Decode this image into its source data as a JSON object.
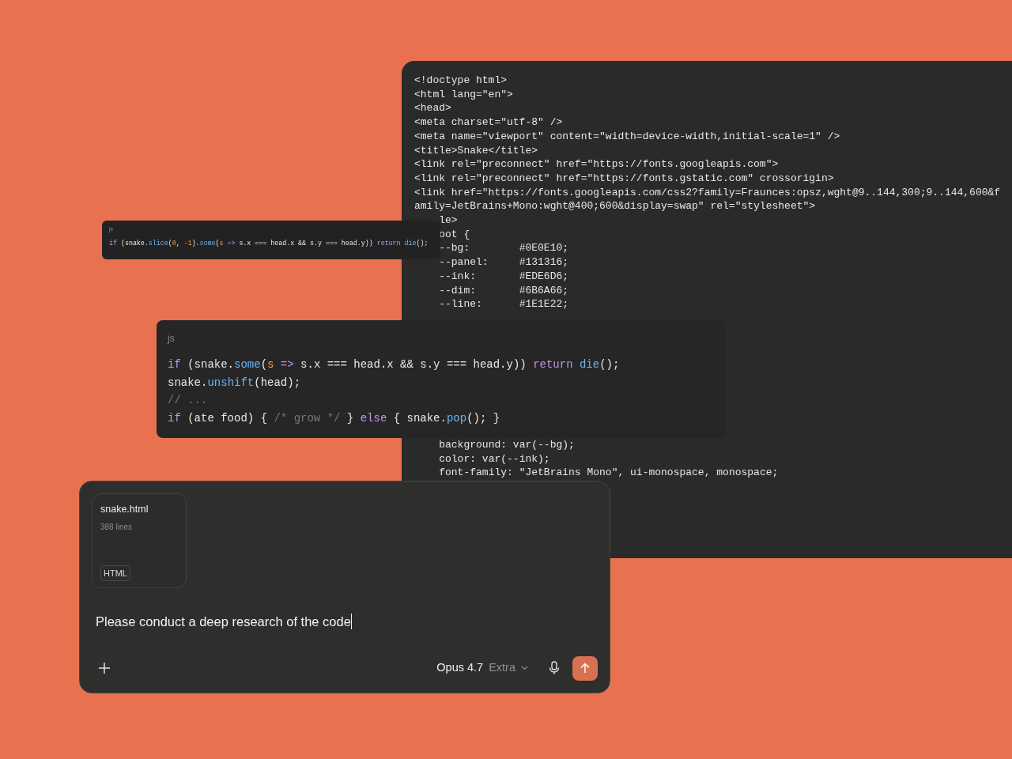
{
  "source_panel": {
    "lines_top": [
      "<!doctype html>",
      "<html lang=\"en\">",
      "<head>",
      "<meta charset=\"utf-8\" />",
      "<meta name=\"viewport\" content=\"width=device-width,initial-scale=1\" />",
      "<title>Snake</title>",
      "<link rel=\"preconnect\" href=\"https://fonts.googleapis.com\">",
      "<link rel=\"preconnect\" href=\"https://fonts.gstatic.com\" crossorigin>",
      "<link href=\"https://fonts.googleapis.com/css2?family=Fraunces:opsz,wght@9..144,300;9..144,600&f",
      "amily=JetBrains+Mono:wght@400;600&display=swap\" rel=\"stylesheet\">",
      "    le>",
      "    oot {",
      "    --bg:        #0E0E10;",
      "    --panel:     #131316;",
      "    --ink:       #EDE6D6;",
      "    --dim:       #6B6A66;",
      "    --line:      #1E1E22;"
    ],
    "lines_bottom": [
      "    background: var(--bg);",
      "    color: var(--ink);",
      "    font-family: \"JetBrains Mono\", ui-monospace, monospace;"
    ]
  },
  "snippets": [
    {
      "language": "js",
      "lines": [
        [
          {
            "kind": "kw",
            "text": "if"
          },
          {
            "kind": "plain",
            "text": " (snake."
          },
          {
            "kind": "fn",
            "text": "slice"
          },
          {
            "kind": "plain",
            "text": "("
          },
          {
            "kind": "num",
            "text": "0"
          },
          {
            "kind": "plain",
            "text": ", "
          },
          {
            "kind": "num",
            "text": "-1"
          },
          {
            "kind": "plain",
            "text": ")."
          },
          {
            "kind": "fn",
            "text": "some"
          },
          {
            "kind": "plain",
            "text": "("
          },
          {
            "kind": "param",
            "text": "s"
          },
          {
            "kind": "kw",
            "text": " =>"
          },
          {
            "kind": "plain",
            "text": " s.x === head.x && s.y === head.y)) "
          },
          {
            "kind": "kw",
            "text": "return"
          },
          {
            "kind": "fn",
            "text": " die"
          },
          {
            "kind": "plain",
            "text": "();"
          }
        ]
      ]
    },
    {
      "language": "js",
      "lines": [
        [
          {
            "kind": "kw",
            "text": "if"
          },
          {
            "kind": "plain",
            "text": " (snake."
          },
          {
            "kind": "fn",
            "text": "some"
          },
          {
            "kind": "plain",
            "text": "("
          },
          {
            "kind": "param",
            "text": "s"
          },
          {
            "kind": "kw",
            "text": " =>"
          },
          {
            "kind": "plain",
            "text": " s.x === head.x && s.y === head.y)) "
          },
          {
            "kind": "kw",
            "text": "return"
          },
          {
            "kind": "fn",
            "text": " die"
          },
          {
            "kind": "plain",
            "text": "();"
          }
        ],
        [
          {
            "kind": "plain",
            "text": "snake."
          },
          {
            "kind": "fn",
            "text": "unshift"
          },
          {
            "kind": "plain",
            "text": "(head);"
          }
        ],
        [
          {
            "kind": "comment",
            "text": "// ..."
          }
        ],
        [
          {
            "kind": "kw",
            "text": "if"
          },
          {
            "kind": "plain",
            "text": " (ate food) { "
          },
          {
            "kind": "comment",
            "text": "/* grow */"
          },
          {
            "kind": "plain",
            "text": " } "
          },
          {
            "kind": "kw",
            "text": "else"
          },
          {
            "kind": "plain",
            "text": " { snake."
          },
          {
            "kind": "fn",
            "text": "pop"
          },
          {
            "kind": "plain",
            "text": "(); }"
          }
        ]
      ]
    }
  ],
  "composer": {
    "attachment": {
      "name": "snake.html",
      "lines": "388 lines",
      "type": "HTML"
    },
    "value": "Please conduct a deep research of the code",
    "model": "Opus 4.7",
    "effort": "Extra"
  }
}
